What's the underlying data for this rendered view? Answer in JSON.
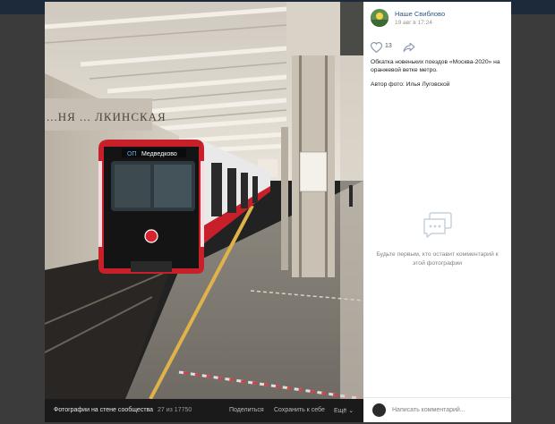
{
  "photo_footer": {
    "album": "Фотографии на стене сообщества",
    "counter": "27 из 17750",
    "share": "Поделиться",
    "save": "Сохранить к себе",
    "more": "Ещё"
  },
  "photo_text": {
    "station_sign": "...НЯ ... ЛКИНСКАЯ",
    "train_display_route": "ОП",
    "train_display_name": "Медведково"
  },
  "post": {
    "group_name": "Наше Свиблово",
    "date": "19 авг в 17:24",
    "likes": "13",
    "description": "Обкатка новеньких поездов «Москва-2020» на оранжевой ветке метро.",
    "author": "Автор фото: Илья Луговской"
  },
  "comments": {
    "empty_text": "Будьте первым, кто оставит комментарий к этой фотографии",
    "placeholder": "Написать комментарий..."
  },
  "colors": {
    "link": "#2a5885",
    "train_red": "#c8202a",
    "safety_line": "#e0b24a"
  }
}
